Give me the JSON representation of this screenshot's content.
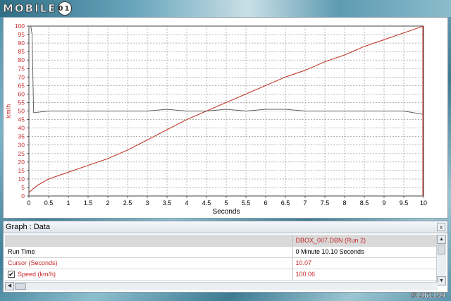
{
  "logo": {
    "text": "MOBILE",
    "mark": "01"
  },
  "watermark": "#1461194",
  "chart_data": {
    "type": "line",
    "xlabel": "Seconds",
    "ylabel": "km/h",
    "xlim": [
      0,
      10
    ],
    "ylim": [
      0,
      100
    ],
    "x_ticks": [
      "0",
      "0.5",
      "1",
      "1.5",
      "2",
      "2.5",
      "3",
      "3.5",
      "4",
      "4.5",
      "5",
      "5.5",
      "6",
      "6.5",
      "7",
      "7.5",
      "8",
      "8.5",
      "9",
      "9.5",
      "10"
    ],
    "y_ticks": [
      "0",
      "5",
      "10",
      "15",
      "20",
      "25",
      "30",
      "35",
      "40",
      "45",
      "50",
      "55",
      "60",
      "65",
      "70",
      "75",
      "80",
      "85",
      "90",
      "95",
      "100"
    ],
    "grid": true,
    "series": [
      {
        "color": "#c0392b",
        "x": [
          0,
          0.2,
          0.5,
          1.0,
          1.5,
          2.0,
          2.5,
          3.0,
          3.5,
          4.0,
          4.5,
          5.0,
          5.5,
          6.0,
          6.5,
          7.0,
          7.5,
          8.0,
          8.5,
          9.0,
          9.5,
          10.0
        ],
        "y": [
          2,
          6,
          10,
          14,
          18,
          22,
          27,
          33,
          39,
          45,
          50,
          55,
          60,
          65,
          70,
          74,
          79,
          83,
          88,
          92,
          96,
          100
        ]
      },
      {
        "color": "#555555",
        "x": [
          0.05,
          0.08,
          0.12,
          0.5,
          1.0,
          1.5,
          2.0,
          2.5,
          3.0,
          3.5,
          4.0,
          4.5,
          5.0,
          5.5,
          6.0,
          6.5,
          7.0,
          7.5,
          8.0,
          8.5,
          9.0,
          9.5,
          10.0
        ],
        "y": [
          100,
          95,
          49,
          50,
          50,
          50,
          50,
          50,
          50,
          51,
          50,
          50,
          51,
          50,
          51,
          51,
          50,
          50,
          50,
          50,
          50,
          50,
          48
        ]
      }
    ]
  },
  "panel": {
    "title": "Graph : Data",
    "close": "x",
    "header": {
      "col2": "DBOX_007.DBN (Run 2)"
    },
    "rows": [
      {
        "label": "Run Time",
        "value": "0 Minute 10.10 Seconds"
      },
      {
        "label": "Cursor (Seconds)",
        "value": "10.07"
      },
      {
        "label": "Speed (km/h)",
        "value": "100.06"
      }
    ],
    "checkbox_mark": "✔"
  }
}
